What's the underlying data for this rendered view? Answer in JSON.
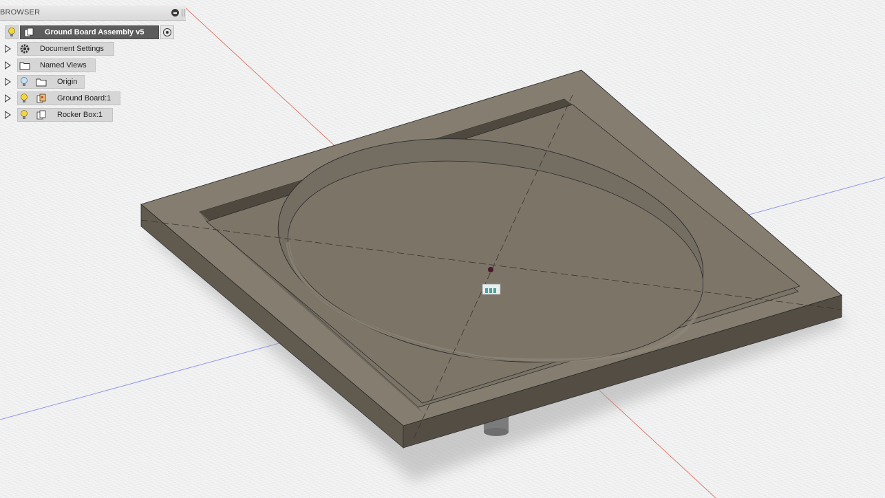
{
  "browser": {
    "title": "BROWSER",
    "root": {
      "label": "Ground Board Assembly v5"
    },
    "items": [
      {
        "label": "Document Settings",
        "icon": "gear-icon"
      },
      {
        "label": "Named Views",
        "icon": "folder-icon"
      },
      {
        "label": "Origin",
        "icon": "folder-icon",
        "visibility": "hidden"
      },
      {
        "label": "Ground Board:1",
        "icon": "component-icon",
        "visibility": "visible"
      },
      {
        "label": "Rocker Box:1",
        "icon": "component-icon",
        "visibility": "visible"
      }
    ]
  },
  "colors": {
    "canvas": "#f3f3f3",
    "grid": "#d9dde0",
    "axis_x": "#e07a6a",
    "axis_y": "#8e95ea",
    "model": "#7f776a",
    "visible_bulb": "#f5d63a",
    "hidden_bulb": "#8fb6d9"
  }
}
